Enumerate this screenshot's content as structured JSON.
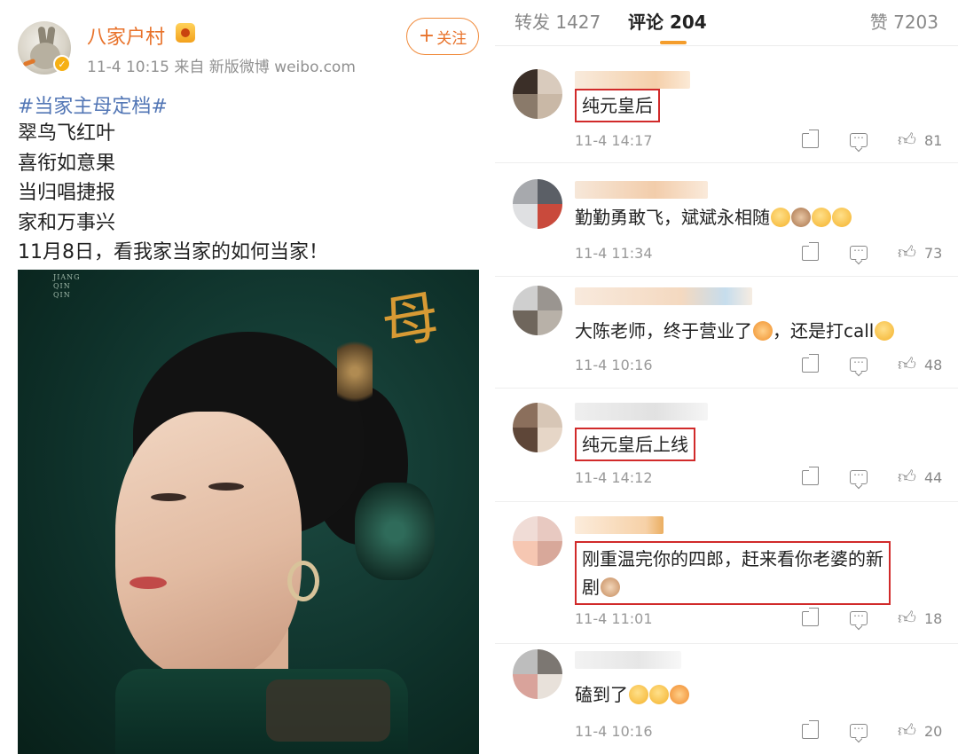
{
  "post": {
    "username": "八家户村",
    "meta": "11-4 10:15  来自 新版微博 weibo.com",
    "follow_label": "关注",
    "follow_plus": "+",
    "hashtag": "#当家主母定档#",
    "lines": [
      "翠鸟飞红叶",
      "喜衔如意果",
      "当归唱捷报",
      "家和万事兴",
      "11月8日，看我家当家的如何当家！"
    ],
    "poster_credit": [
      "JIANG",
      "QIN",
      "QIN"
    ],
    "poster_calligraphy": "母"
  },
  "tabs": {
    "repost": "转发 1427",
    "comment": "评论 204",
    "like": "赞 7203"
  },
  "comments": [
    {
      "text": "纯元皇后",
      "time": "11-4 14:17",
      "likes": "81",
      "boxed": true,
      "emoji_count": 0
    },
    {
      "text": "勤勤勇敢飞，斌斌永相随",
      "time": "11-4 11:34",
      "likes": "73",
      "boxed": false,
      "emoji_count": 4
    },
    {
      "text": "大陈老师，终于营业了",
      "text2": "，还是打call",
      "time": "11-4 10:16",
      "likes": "48",
      "boxed": false
    },
    {
      "text": "纯元皇后上线",
      "time": "11-4 14:12",
      "likes": "44",
      "boxed": true
    },
    {
      "text": "刚重温完你的四郎，赶来看你老婆的新",
      "text_line2": "剧",
      "time": "11-4 11:01",
      "likes": "18",
      "boxed": true
    },
    {
      "text": "磕到了",
      "time": "11-4 10:16",
      "likes": "20",
      "boxed": false
    }
  ],
  "colors": {
    "username": "#e8722a",
    "hashtag": "#5276b5",
    "tab_underline": "#f49d2c",
    "highlight_box": "#d12a2a"
  },
  "icons": {
    "share": "share-icon",
    "comment": "comment-icon",
    "like": "thumbs-up-icon"
  }
}
